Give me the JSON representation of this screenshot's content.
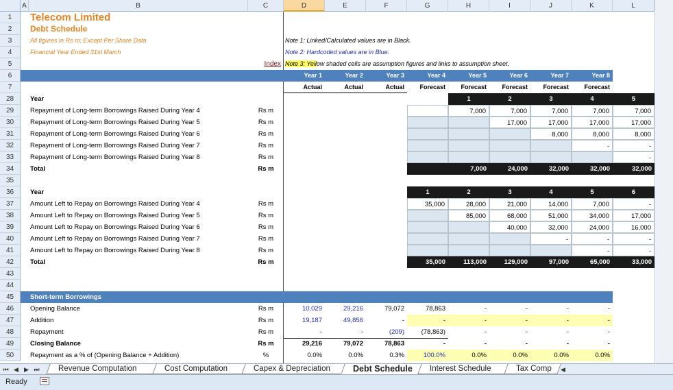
{
  "columns": [
    "A",
    "B",
    "C",
    "D",
    "E",
    "F",
    "G",
    "H",
    "I",
    "J",
    "K",
    "L"
  ],
  "selected_column": "D",
  "rows": [
    "1",
    "2",
    "3",
    "4",
    "5",
    "6",
    "7",
    "28",
    "29",
    "30",
    "31",
    "32",
    "33",
    "34",
    "35",
    "36",
    "37",
    "38",
    "39",
    "40",
    "41",
    "42",
    "43",
    "44",
    "45",
    "46",
    "47",
    "48",
    "49",
    "50"
  ],
  "header": {
    "company": "Telecom Limited",
    "title": "Debt Schedule",
    "subtitle1": "All figures in Rs m; Except Per Share Data",
    "subtitle2": "Financial Year Ended 31st March",
    "index_link": "Index",
    "note1": "Note 1: Linked/Calculated values are in Black.",
    "note2": "Note 2: Hardcoded values are in Blue.",
    "note3_highlight": "Note 3: Yell",
    "note3_rest": "ow shaded cells are assumption figures and links to assumption sheet.",
    "years": [
      "Year 1",
      "Year 2",
      "Year 3",
      "Year 4",
      "Year 5",
      "Year 6",
      "Year 7",
      "Year 8"
    ],
    "types": [
      "Actual",
      "Actual",
      "Actual",
      "Forecast",
      "Forecast",
      "Forecast",
      "Forecast",
      "Forecast"
    ]
  },
  "repayment": {
    "year_label": "Year",
    "year_numbers": [
      "1",
      "2",
      "3",
      "4",
      "5"
    ],
    "unit": "Rs m",
    "rows": [
      {
        "label": "Repayment of Long-term Borrowings Raised During Year 4",
        "values": [
          "7,000",
          "7,000",
          "7,000",
          "7,000",
          "7,000"
        ]
      },
      {
        "label": "Repayment of Long-term Borrowings Raised During Year 5",
        "values": [
          "",
          "17,000",
          "17,000",
          "17,000",
          "17,000"
        ]
      },
      {
        "label": "Repayment of Long-term Borrowings Raised During Year 6",
        "values": [
          "",
          "",
          "8,000",
          "8,000",
          "8,000"
        ]
      },
      {
        "label": "Repayment of Long-term Borrowings Raised During Year 7",
        "values": [
          "",
          "",
          "",
          "-",
          "-"
        ]
      },
      {
        "label": "Repayment of Long-term Borrowings Raised During Year 8",
        "values": [
          "",
          "",
          "",
          "",
          "-"
        ]
      }
    ],
    "total_label": "Total",
    "totals": [
      "7,000",
      "24,000",
      "32,000",
      "32,000",
      "32,000"
    ]
  },
  "amount_left": {
    "year_label": "Year",
    "year_numbers": [
      "1",
      "2",
      "3",
      "4",
      "5",
      "6"
    ],
    "unit": "Rs m",
    "rows": [
      {
        "label": "Amount Left to Repay on Borrowings Raised During Year 4",
        "values": [
          "35,000",
          "28,000",
          "21,000",
          "14,000",
          "7,000",
          "-"
        ]
      },
      {
        "label": "Amount Left to Repay on Borrowings Raised During Year 5",
        "values": [
          "",
          "85,000",
          "68,000",
          "51,000",
          "34,000",
          "17,000"
        ]
      },
      {
        "label": "Amount Left to Repay on Borrowings Raised During Year 6",
        "values": [
          "",
          "",
          "40,000",
          "32,000",
          "24,000",
          "16,000"
        ]
      },
      {
        "label": "Amount Left to Repay on Borrowings Raised During Year 7",
        "values": [
          "",
          "",
          "",
          "-",
          "-",
          "-"
        ]
      },
      {
        "label": "Amount Left to Repay on Borrowings Raised During Year 8",
        "values": [
          "",
          "",
          "",
          "",
          "-",
          "-"
        ]
      }
    ],
    "total_label": "Total",
    "totals": [
      "35,000",
      "113,000",
      "129,000",
      "97,000",
      "65,000",
      "33,000"
    ]
  },
  "short_term": {
    "section_title": "Short-term Borrowings",
    "rows": [
      {
        "label": "Opening Balance",
        "unit": "Rs m",
        "values": [
          "10,029",
          "29,216",
          "79,072",
          "78,863",
          "-",
          "-",
          "-",
          "-"
        ]
      },
      {
        "label": "Addition",
        "unit": "Rs m",
        "values": [
          "19,187",
          "49,856",
          "-",
          "-",
          "-",
          "-",
          "-",
          "-"
        ]
      },
      {
        "label": "Repayment",
        "unit": "Rs m",
        "values": [
          "-",
          "-",
          "(209)",
          "(78,863)",
          "-",
          "-",
          "-",
          "-"
        ]
      },
      {
        "label": "Closing Balance",
        "unit": "Rs m",
        "values": [
          "29,216",
          "79,072",
          "78,863",
          "-",
          "-",
          "-",
          "-",
          "-"
        ]
      },
      {
        "label": "Repayment as a % of (Opening Balance + Addition)",
        "unit": "%",
        "values": [
          "0.0%",
          "0.0%",
          "0.3%",
          "100.0%",
          "0.0%",
          "0.0%",
          "0.0%",
          "0.0%"
        ]
      }
    ]
  },
  "tabs": [
    "Revenue Computation",
    "Cost Computation",
    "Capex & Depreciation",
    "Debt Schedule",
    "Interest Schedule",
    "Tax Comp"
  ],
  "active_tab": "Debt Schedule",
  "status": "Ready",
  "colors": {
    "header_blue": "#4f81bd",
    "accent_orange": "#e3862a",
    "hardcode_blue": "#1f2db8",
    "assumption_yellow": "#ffffb4",
    "total_black": "#1a1a1a"
  }
}
